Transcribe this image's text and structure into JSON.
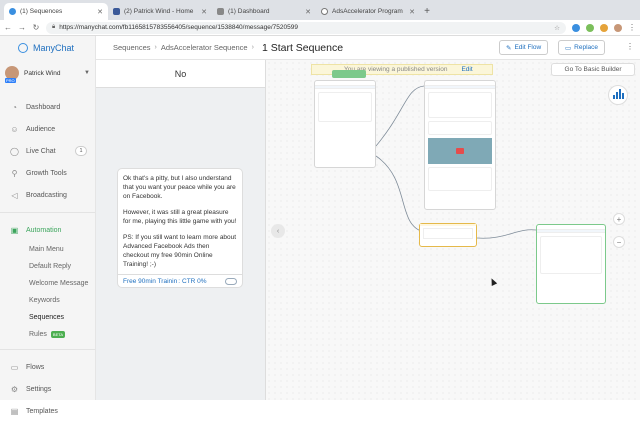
{
  "browser": {
    "tabs": [
      {
        "title": "(1) Sequences",
        "favicon_color": "#3a8fe0",
        "active": true
      },
      {
        "title": "(2) Patrick Wind - Home",
        "favicon_color": "#3b5998",
        "active": false
      },
      {
        "title": "(1) Dashboard",
        "favicon_color": "#888888",
        "active": false
      },
      {
        "title": "AdsAccelerator Program",
        "favicon_color": "#777777",
        "active": false
      }
    ],
    "url": "https://manychat.com/fb1165815783556405/sequence/1538840/message/7520599"
  },
  "sidebar": {
    "brand": "ManyChat",
    "user": {
      "name": "Patrick Wind",
      "badge": "PRO"
    },
    "nav": [
      {
        "label": "Dashboard",
        "icon": "dashboard-icon"
      },
      {
        "label": "Audience",
        "icon": "audience-icon"
      },
      {
        "label": "Live Chat",
        "icon": "chat-icon",
        "count": "1"
      },
      {
        "label": "Growth Tools",
        "icon": "growth-icon"
      },
      {
        "label": "Broadcasting",
        "icon": "broadcast-icon"
      }
    ],
    "automation": {
      "label": "Automation",
      "items": [
        "Main Menu",
        "Default Reply",
        "Welcome Message",
        "Keywords",
        "Sequences",
        "Rules"
      ],
      "rules_badge": "BETA"
    },
    "bottom": [
      {
        "label": "Flows",
        "icon": "flows-icon"
      },
      {
        "label": "Settings",
        "icon": "settings-icon"
      },
      {
        "label": "Templates",
        "icon": "templates-icon"
      }
    ]
  },
  "header": {
    "breadcrumb": [
      "Sequences",
      "AdsAccelerator Sequence"
    ],
    "title": "1 Start Sequence",
    "edit_flow": "Edit Flow",
    "replace": "Replace"
  },
  "preview": {
    "title": "No",
    "paragraphs": [
      "Ok that's a pitty, but I also understand that you want your peace while you are on Facebook.",
      "However, it was still a great pleasure for me, playing this little game with you!",
      "PS: If you still want to learn more about Advanced Facebook Ads then checkout my free 90min Online Training! ;-)"
    ],
    "button_label": "Free 90min Trainin",
    "button_ctr": "CTR 0%"
  },
  "canvas": {
    "banner_text": "You are viewing a published version",
    "banner_edit": "Edit",
    "basic_builder": "Go To Basic Builder"
  },
  "colors": {
    "accent": "#1e6fbf",
    "automation": "#3ba55c",
    "selected_border": "#7cc98b"
  }
}
